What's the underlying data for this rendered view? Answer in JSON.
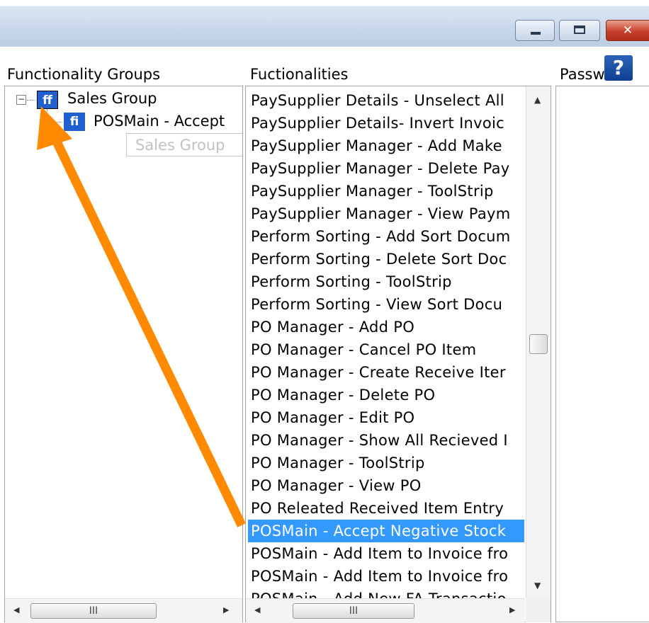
{
  "window": {
    "minimize_glyph": "",
    "maximize_glyph": "",
    "close_glyph": "✕",
    "help_label": "?"
  },
  "headers": {
    "groups": "Functionality Groups",
    "functionalities": "Fuctionalities",
    "password": "Passw"
  },
  "tree": {
    "expander": "⊟",
    "root": {
      "icon": "ff",
      "label": "Sales Group"
    },
    "child": {
      "icon": "fi",
      "label": "POSMain - Accept"
    },
    "tooltip": "Sales Group"
  },
  "functionalities": [
    "PaySupplier Details - Unselect All",
    "PaySupplier Details- Invert Invoic",
    "PaySupplier Manager - Add Make",
    "PaySupplier Manager - Delete Pay",
    "PaySupplier Manager - ToolStrip",
    "PaySupplier Manager - View Paym",
    "Perform Sorting - Add Sort Docum",
    "Perform Sorting - Delete Sort Doc",
    "Perform Sorting - ToolStrip",
    "Perform Sorting - View  Sort Docu",
    "PO Manager - Add PO",
    "PO Manager - Cancel PO Item",
    "PO Manager - Create Receive Iter",
    "PO Manager - Delete PO",
    "PO Manager - Edit PO",
    "PO Manager - Show All Recieved I",
    "PO Manager - ToolStrip",
    "PO Manager - View PO",
    "PO Releated Received Item Entry",
    "POSMain - Accept Negative Stock",
    "POSMain - Add Item to Invoice fro",
    "POSMain - Add Item to Invoice fro",
    "POSMain - Add New FA Transactio"
  ],
  "selected_index": 19,
  "scroll": {
    "up": "▲",
    "down": "▼",
    "left": "◀",
    "right": "▶",
    "grip": "III"
  },
  "colors": {
    "selection": "#3399ff",
    "annotation_arrow": "#ff8a00",
    "tree_icon": "#1f5fd0"
  }
}
